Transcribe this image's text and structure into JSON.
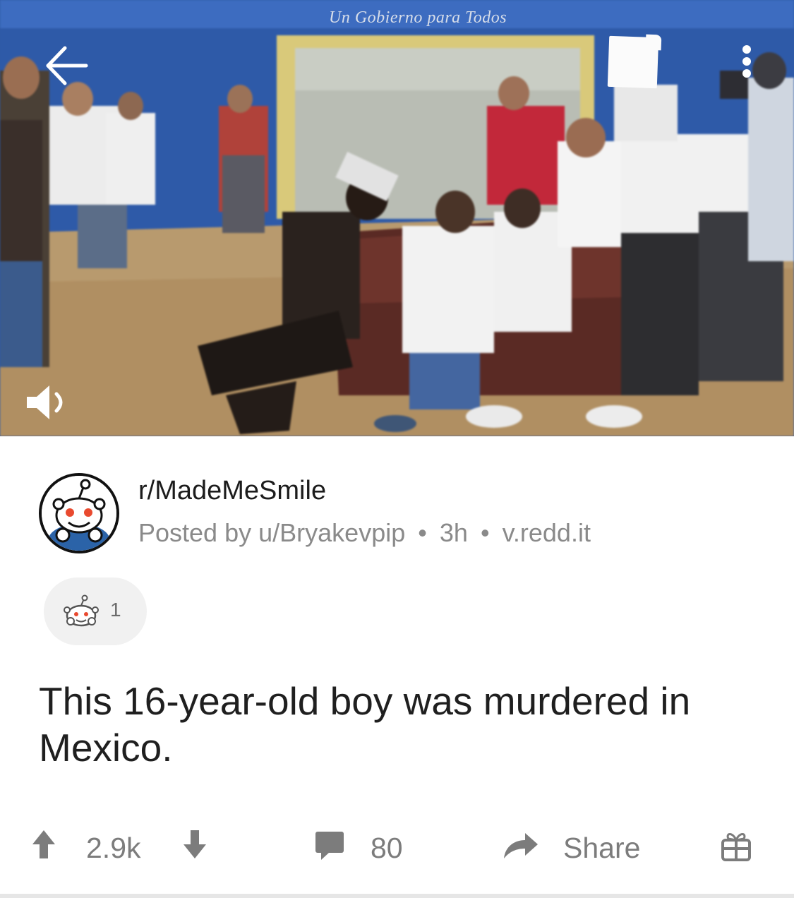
{
  "video": {
    "banner_text": "Un Gobierno para Todos",
    "icons": {
      "back": "arrow-left-icon",
      "more": "more-vertical-icon",
      "volume": "volume-icon"
    }
  },
  "post": {
    "subreddit": "r/MadeMeSmile",
    "posted_by_prefix": "Posted by",
    "author": "u/Bryakevpip",
    "age": "3h",
    "domain": "v.redd.it",
    "separator": "•",
    "award_count": "1",
    "title": "This 16-year-old boy was murdered in Mexico."
  },
  "actions": {
    "score": "2.9k",
    "comments": "80",
    "share_label": "Share"
  },
  "colors": {
    "text_primary": "#1f1f1f",
    "text_secondary": "#8a8a8a",
    "action_gray": "#7c7c7c",
    "pill_bg": "#f1f1f1"
  }
}
